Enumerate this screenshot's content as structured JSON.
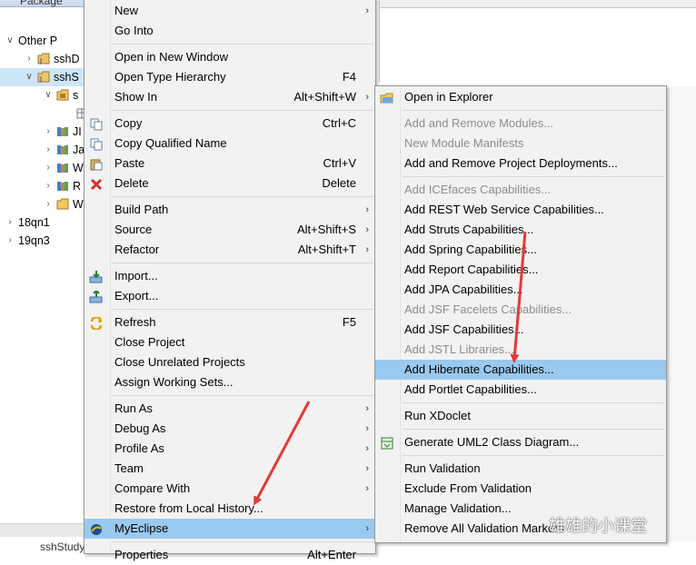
{
  "explorer": {
    "tab_label": "Package",
    "rows": [
      {
        "label": "Other P",
        "twisty": "v",
        "icon": "working-set-icon",
        "indent": 0
      },
      {
        "label": "sshD",
        "twisty": ">",
        "icon": "project-icon",
        "indent": 1
      },
      {
        "label": "sshS",
        "twisty": "v",
        "icon": "project-icon",
        "indent": 1,
        "selected": true
      },
      {
        "label": "s",
        "twisty": "v",
        "icon": "source-folder-icon",
        "indent": 2
      },
      {
        "label": "",
        "twisty": "",
        "icon": "package-icon",
        "indent": 3
      },
      {
        "label": "JI",
        "twisty": ">",
        "icon": "library-icon",
        "indent": 2
      },
      {
        "label": "Ja",
        "twisty": ">",
        "icon": "library-icon",
        "indent": 2
      },
      {
        "label": "W",
        "twisty": ">",
        "icon": "library-icon",
        "indent": 2
      },
      {
        "label": "R",
        "twisty": ">",
        "icon": "library-icon",
        "indent": 2
      },
      {
        "label": "W",
        "twisty": ">",
        "icon": "folder-icon",
        "indent": 2
      },
      {
        "label": "18qn1",
        "twisty": ">",
        "icon": "working-set-icon",
        "indent": 0
      },
      {
        "label": "19qn3",
        "twisty": ">",
        "icon": "working-set-icon",
        "indent": 0
      }
    ],
    "bottom_text": "sshStudy"
  },
  "context_menu": {
    "items": [
      {
        "label": "New",
        "shortcut": "",
        "submenu": true
      },
      {
        "label": "Go Into",
        "shortcut": ""
      },
      {
        "sep": true
      },
      {
        "label": "Open in New Window",
        "shortcut": ""
      },
      {
        "label": "Open Type Hierarchy",
        "shortcut": "F4"
      },
      {
        "label": "Show In",
        "shortcut": "Alt+Shift+W",
        "submenu": true
      },
      {
        "sep": true
      },
      {
        "label": "Copy",
        "shortcut": "Ctrl+C",
        "icon": "copy-icon"
      },
      {
        "label": "Copy Qualified Name",
        "shortcut": "",
        "icon": "copy-icon"
      },
      {
        "label": "Paste",
        "shortcut": "Ctrl+V",
        "icon": "paste-icon"
      },
      {
        "label": "Delete",
        "shortcut": "Delete",
        "icon": "delete-icon"
      },
      {
        "sep": true
      },
      {
        "label": "Build Path",
        "shortcut": "",
        "submenu": true
      },
      {
        "label": "Source",
        "shortcut": "Alt+Shift+S",
        "submenu": true
      },
      {
        "label": "Refactor",
        "shortcut": "Alt+Shift+T",
        "submenu": true
      },
      {
        "sep": true
      },
      {
        "label": "Import...",
        "shortcut": "",
        "icon": "import-icon"
      },
      {
        "label": "Export...",
        "shortcut": "",
        "icon": "export-icon"
      },
      {
        "sep": true
      },
      {
        "label": "Refresh",
        "shortcut": "F5",
        "icon": "refresh-icon"
      },
      {
        "label": "Close Project",
        "shortcut": ""
      },
      {
        "label": "Close Unrelated Projects",
        "shortcut": ""
      },
      {
        "label": "Assign Working Sets...",
        "shortcut": ""
      },
      {
        "sep": true
      },
      {
        "label": "Run As",
        "shortcut": "",
        "submenu": true
      },
      {
        "label": "Debug As",
        "shortcut": "",
        "submenu": true
      },
      {
        "label": "Profile As",
        "shortcut": "",
        "submenu": true
      },
      {
        "label": "Team",
        "shortcut": "",
        "submenu": true
      },
      {
        "label": "Compare With",
        "shortcut": "",
        "submenu": true
      },
      {
        "label": "Restore from Local History...",
        "shortcut": ""
      },
      {
        "label": "MyEclipse",
        "shortcut": "",
        "submenu": true,
        "highlighted": true,
        "icon": "myeclipse-icon"
      },
      {
        "sep": true
      },
      {
        "label": "Properties",
        "shortcut": "Alt+Enter"
      }
    ]
  },
  "submenu": {
    "items": [
      {
        "label": "Open in Explorer",
        "icon": "open-explorer-icon"
      },
      {
        "sep": true
      },
      {
        "label": "Add and Remove Modules...",
        "disabled": true
      },
      {
        "label": "New Module Manifests",
        "disabled": true
      },
      {
        "label": "Add and Remove Project Deployments..."
      },
      {
        "sep": true
      },
      {
        "label": "Add ICEfaces Capabilities...",
        "disabled": true
      },
      {
        "label": "Add REST Web Service Capabilities..."
      },
      {
        "label": "Add Struts Capabilities..."
      },
      {
        "label": "Add Spring Capabilities..."
      },
      {
        "label": "Add Report Capabilities..."
      },
      {
        "label": "Add JPA Capabilities..."
      },
      {
        "label": "Add JSF Facelets Capabilities...",
        "disabled": true
      },
      {
        "label": "Add JSF Capabilities..."
      },
      {
        "label": "Add JSTL Libraries...",
        "disabled": true
      },
      {
        "label": "Add Hibernate Capabilities...",
        "highlighted": true
      },
      {
        "label": "Add Portlet Capabilities..."
      },
      {
        "sep": true
      },
      {
        "label": "Run XDoclet"
      },
      {
        "sep": true
      },
      {
        "label": "Generate UML2 Class Diagram...",
        "icon": "uml-icon"
      },
      {
        "sep": true
      },
      {
        "label": "Run Validation"
      },
      {
        "label": "Exclude From Validation"
      },
      {
        "label": "Manage Validation..."
      },
      {
        "label": "Remove All Validation Markers"
      }
    ]
  },
  "annotations": {
    "arrow_color": "#e53935",
    "watermark": "雄雄的小课堂"
  },
  "colors": {
    "menu_bg": "#f2f2f2",
    "highlight": "#99c9ef",
    "disabled_text": "#8d8d8d"
  }
}
